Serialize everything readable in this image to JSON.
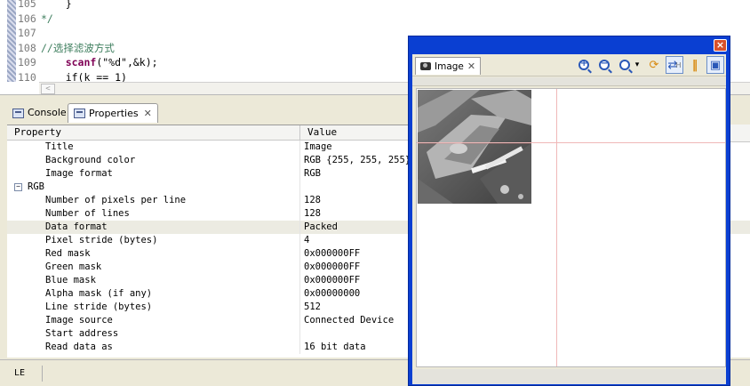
{
  "editor": {
    "lines": [
      {
        "num": "105",
        "text": "    }"
      },
      {
        "num": "106",
        "text": "*/"
      },
      {
        "num": "107",
        "text": ""
      },
      {
        "num": "108",
        "text": "//选择滤波方式"
      },
      {
        "num": "109",
        "kw": "scanf",
        "args": "(\"%d\",&k);"
      },
      {
        "num": "110",
        "text": "    if(k == 1)"
      }
    ]
  },
  "tabs": {
    "console": "Console",
    "properties": "Properties"
  },
  "properties": {
    "header": {
      "property": "Property",
      "value": "Value"
    },
    "rows": [
      {
        "name": "Title",
        "value": "Image"
      },
      {
        "name": "Background color",
        "value": "RGB {255, 255, 255}"
      },
      {
        "name": "Image format",
        "value": "RGB"
      },
      {
        "name": "RGB",
        "value": "",
        "group": true
      },
      {
        "name": "Number of pixels per line",
        "value": "128"
      },
      {
        "name": "Number of lines",
        "value": "128"
      },
      {
        "name": "Data format",
        "value": "Packed",
        "selected": true
      },
      {
        "name": "Pixel stride (bytes)",
        "value": "4"
      },
      {
        "name": "Red mask",
        "value": "0x000000FF"
      },
      {
        "name": "Green mask",
        "value": "0x000000FF"
      },
      {
        "name": "Blue mask",
        "value": "0x000000FF"
      },
      {
        "name": "Alpha mask (if any)",
        "value": "0x00000000"
      },
      {
        "name": "Line stride (bytes)",
        "value": "512"
      },
      {
        "name": "Image source",
        "value": "Connected Device"
      },
      {
        "name": "Start address",
        "value": ""
      },
      {
        "name": "Read data as",
        "value": "16 bit data"
      }
    ]
  },
  "status": {
    "mode": "LE"
  },
  "image_window": {
    "tab_label": "Image",
    "close": "×",
    "tools": [
      "zoom-in-icon",
      "zoom-out-icon",
      "zoom-fit-icon",
      "refresh-icon",
      "sync-icon",
      "pause-icon",
      "properties-icon"
    ],
    "zoom_in_sign": "+",
    "zoom_out_sign": "−",
    "dropdown": "▾",
    "refresh_glyph": "⟳",
    "sync_glyph": "⇄",
    "pause_glyph": "‖",
    "props_glyph": "▣",
    "hint": "H"
  }
}
